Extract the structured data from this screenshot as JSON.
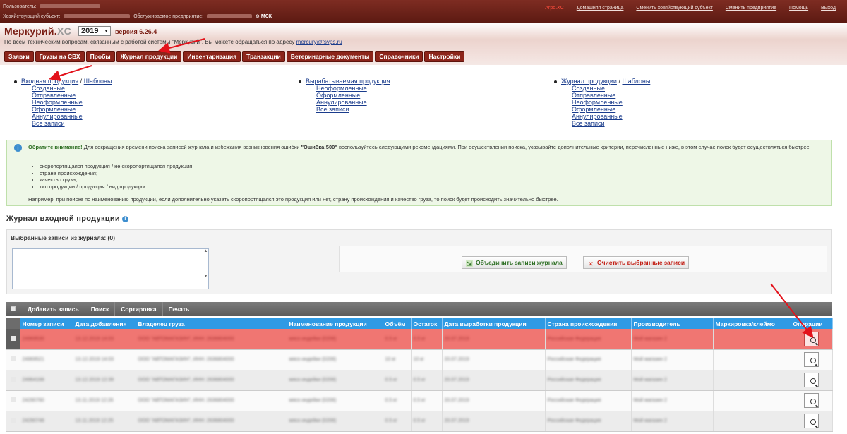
{
  "topbar": {
    "user_label": "Пользователь:",
    "entity_label": "Хозяйствующий субъект:",
    "enterprise_label": "Обслуживаемое предприятие:",
    "timezone": "МСК",
    "links": [
      {
        "label": "Агро.XC",
        "emphasis": true
      },
      {
        "label": "Домашняя страница"
      },
      {
        "label": "Сменить хозяйствующий субъект"
      },
      {
        "label": "Сменить предприятие"
      },
      {
        "label": "Помощь"
      },
      {
        "label": "Выход"
      }
    ]
  },
  "header": {
    "logo_main": "Меркурий.",
    "logo_xc": "XC",
    "year": "2019",
    "version": "версия 6.26.4",
    "support_text": "По всем техническим вопросам, связанным с работой системы \"Меркурий\", Вы можете обращаться по адресу",
    "support_email": "mercury@fsvps.ru"
  },
  "nav": {
    "tabs": [
      "Заявки",
      "Грузы на СВХ",
      "Пробы",
      "Журнал продукции",
      "Инвентаризация",
      "Транзакции",
      "Ветеринарные документы",
      "Справочники",
      "Настройки"
    ]
  },
  "menus": {
    "incoming": {
      "title": "Входная продукция",
      "sep": "/",
      "templates": "Шаблоны",
      "items": [
        "Созданные",
        "Отправленные",
        "Неоформленные",
        "Оформленные",
        "Аннулированные",
        "Все записи"
      ]
    },
    "produced": {
      "title": "Вырабатываемая продукция",
      "items": [
        "Неоформленные",
        "Оформленные",
        "Аннулированные",
        "Все записи"
      ]
    },
    "journal": {
      "title": "Журнал продукции",
      "sep": "/",
      "templates": "Шаблоны",
      "items": [
        "Созданные",
        "Отправленные",
        "Неоформленные",
        "Оформленные",
        "Аннулированные",
        "Все записи"
      ]
    }
  },
  "notice": {
    "bold": "Обратите внимание!",
    "text1": "Для сокращения времени поиска записей журнала и избежания возникновения ошибки",
    "err": "\"Ошибка:500\"",
    "text2": "воспользуйтесь следующими рекомендациями. При осуществлении поиска, указывайте дополнительные критерии, перечисленные ниже, в этом случае поиск будет осуществляться быстрее",
    "items": [
      "скоропортящаяся продукция / не скоропортящаяся продукция;",
      "страна происхождения;",
      "качество груза;",
      "тип продукции / продукция / вид продукции."
    ],
    "example": "Например, при поиске по наименованию продукции, если дополнительно указать скоропортящаяся это продукция или нет, страну происхождения и качество груза, то поиск будет происходить значительно быстрее."
  },
  "journal": {
    "title": "Журнал входной продукции",
    "selected_label": "Выбранные записи из журнала: (0)",
    "merge_button": "Объединить записи журнала",
    "clear_button": "Очистить выбранные записи"
  },
  "toolbar": {
    "items": [
      "Добавить запись",
      "Поиск",
      "Сортировка",
      "Печать"
    ]
  },
  "table": {
    "headers": [
      "Номер записи",
      "Дата добавления",
      "Владелец груза",
      "Наименование продукции",
      "Объём",
      "Остаток",
      "Дата выработки продукции",
      "Страна происхождения",
      "Производитель",
      "Маркировка/клеймо",
      "Операции"
    ],
    "rows": [
      {
        "number": "24969530",
        "date": "13.12.2019 14:03",
        "owner": "ООО \"АВТОМАГАЗИН\", ИНН: 2636804000",
        "product": "мясо индейки (0206)",
        "volume": "0.5 кг",
        "rest": "0.5 кг",
        "prod_date": "20.07.2019",
        "country": "Российская Федерация",
        "maker": "Мой магазин 2",
        "mark": ""
      },
      {
        "number": "24969521",
        "date": "13.12.2019 14:03",
        "owner": "ООО \"АВТОМАГАЗИН\", ИНН: 2636804000",
        "product": "мясо индейки (0206)",
        "volume": "10 кг",
        "rest": "10 кг",
        "prod_date": "20.07.2019",
        "country": "Российская Федерация",
        "maker": "Мой магазин 2",
        "mark": ""
      },
      {
        "number": "24964168",
        "date": "13.12.2019 12:39",
        "owner": "ООО \"АВТОМАГАЗИН\", ИНН: 2636804000",
        "product": "мясо индейки (0206)",
        "volume": "0.5 кг",
        "rest": "0.5 кг",
        "prod_date": "20.07.2019",
        "country": "Российская Федерация",
        "maker": "Мой магазин 2",
        "mark": ""
      },
      {
        "number": "24290760",
        "date": "13.11.2019 12:26",
        "owner": "ООО \"АВТОМАГАЗИН\", ИНН: 2636804000",
        "product": "мясо индейки (0206)",
        "volume": "0.5 кг",
        "rest": "0.5 кг",
        "prod_date": "20.07.2019",
        "country": "Российская Федерация",
        "maker": "Мой магазин 2",
        "mark": ""
      },
      {
        "number": "24290748",
        "date": "13.11.2019 12:25",
        "owner": "ООО \"АВТОМАГАЗИН\", ИНН: 2636804000",
        "product": "мясо индейки (0206)",
        "volume": "0.5 кг",
        "rest": "0.5 кг",
        "prod_date": "20.07.2019",
        "country": "Российская Федерация",
        "maker": "Мой магазин 2",
        "mark": ""
      }
    ]
  },
  "colors": {
    "brand": "#7a1e14",
    "tab": "#8c241a",
    "header_blue": "#2f9ae4",
    "highlight_row": "#f07672",
    "annotation_arrow": "#e3121b"
  }
}
